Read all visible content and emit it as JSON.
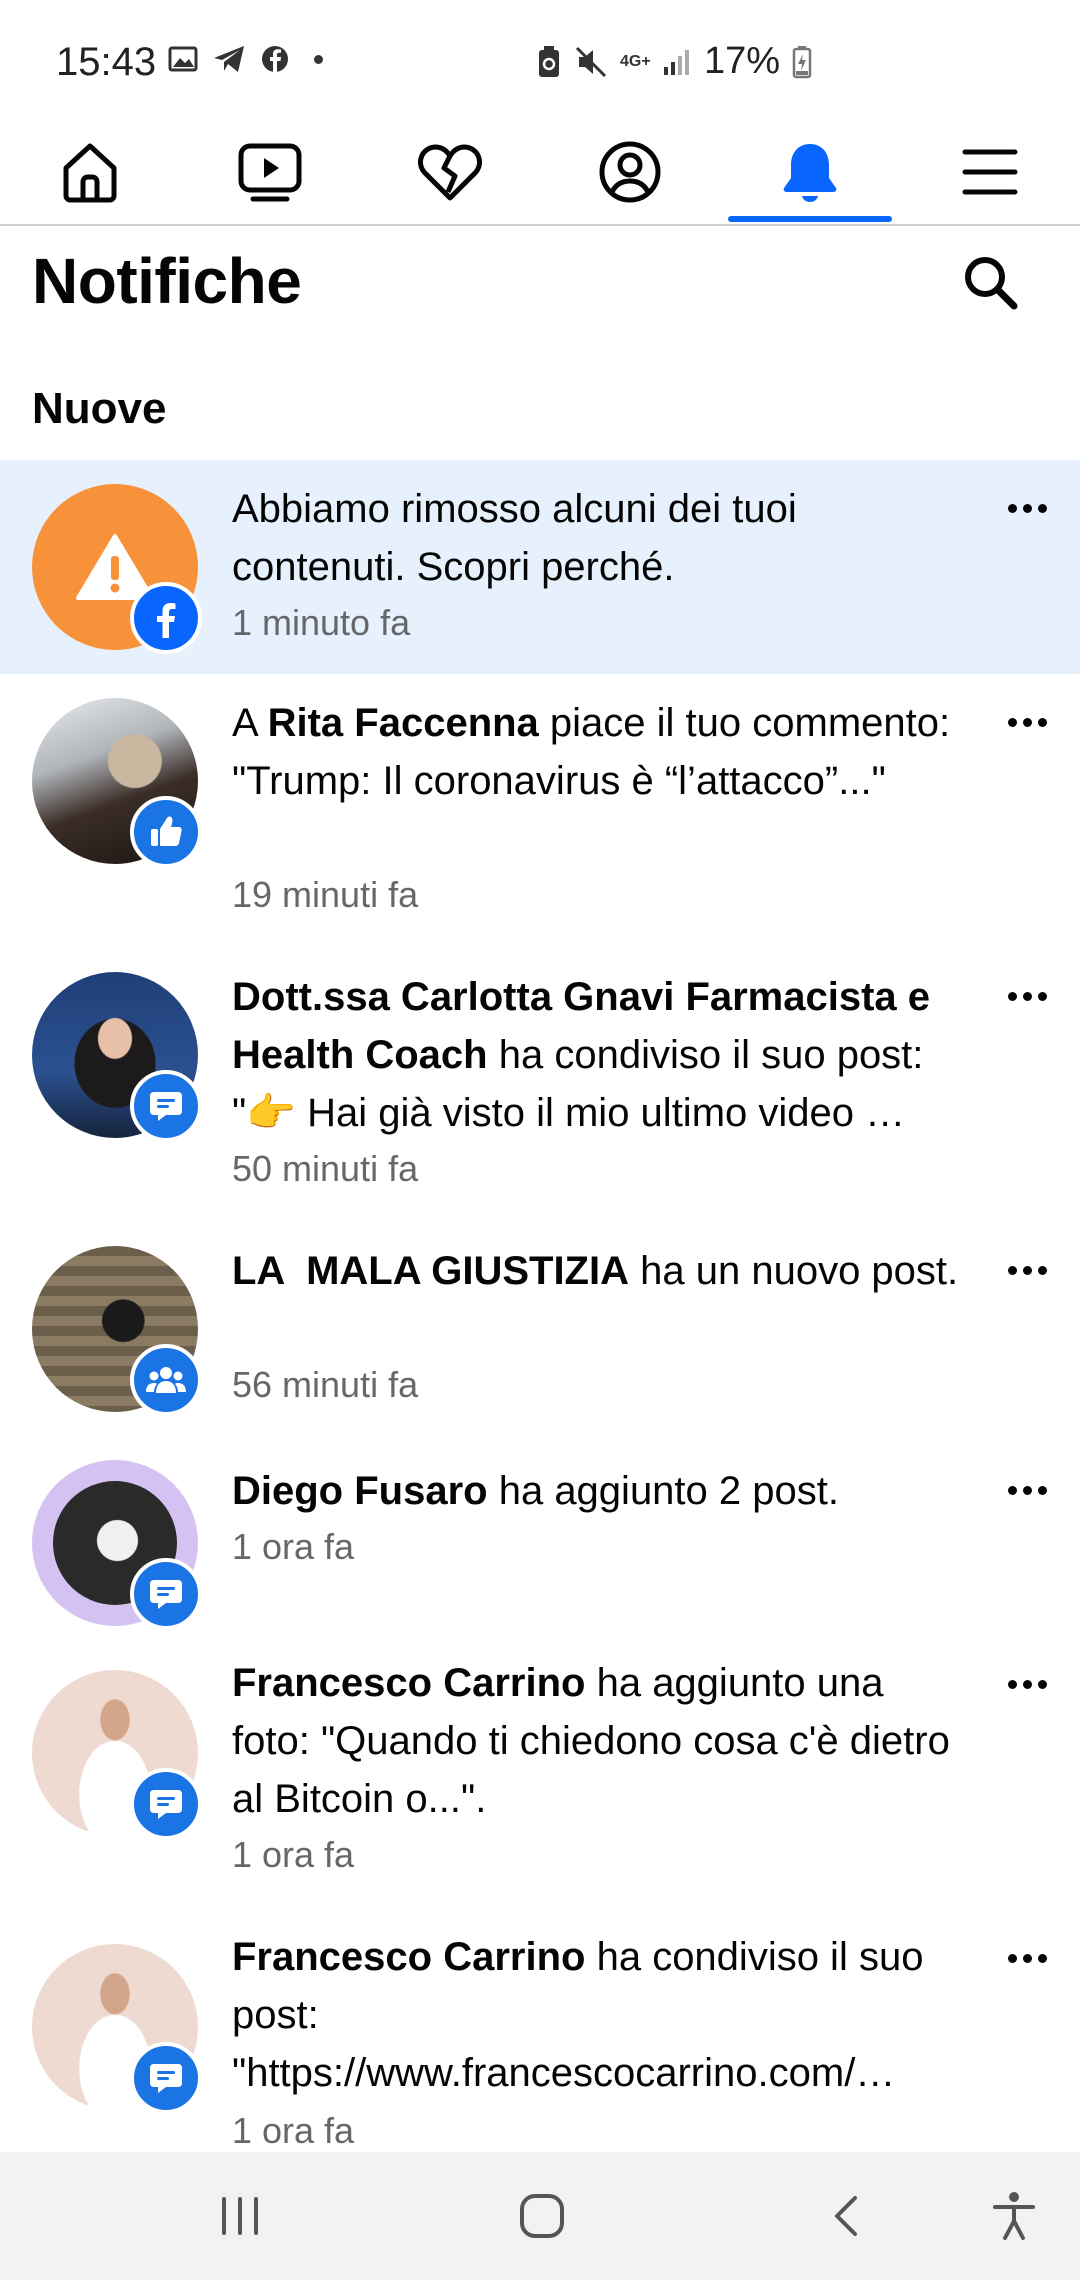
{
  "status": {
    "time": "15:43",
    "battery": "17%",
    "network": "4G+"
  },
  "nav": {
    "items": [
      "home-icon",
      "video-icon",
      "dating-heart-icon",
      "profile-icon",
      "notifications-bell-icon",
      "menu-icon"
    ],
    "active": "notifications-bell-icon",
    "accent": "#0866ff"
  },
  "header": {
    "title": "Notifiche",
    "section": "Nuove"
  },
  "notifications": [
    {
      "pre": "",
      "bold": "",
      "text": "Abbiamo rimosso alcuni dei tuoi contenuti. Scopri perché.",
      "time": "1 minuto fa",
      "badge": "facebook-icon",
      "unread": true
    },
    {
      "pre": "A ",
      "bold": "Rita Faccenna",
      "text": " piace il tuo commento: \"Trump: Il coronavirus è “l’attacco”...\"",
      "time": "19 minuti fa",
      "badge": "like-thumb-icon"
    },
    {
      "pre": "",
      "bold": "Dott.ssa Carlotta Gnavi Farmacista e Health Coach",
      "text": " ha condiviso il suo post: \"👉 Hai già visto il mio ultimo video …",
      "time": "50 minuti fa",
      "badge": "comment-icon"
    },
    {
      "pre": "",
      "bold": "LA  MALA GIUSTIZIA",
      "text": " ha un nuovo post.",
      "time": "56 minuti fa",
      "badge": "group-icon"
    },
    {
      "pre": "",
      "bold": "Diego Fusaro",
      "text": " ha aggiunto 2 post.",
      "time": "1 ora fa",
      "badge": "comment-icon"
    },
    {
      "pre": "",
      "bold": "Francesco Carrino",
      "text": " ha aggiunto una foto: \"Quando ti chiedono cosa c'è dietro al Bitcoin o...\".",
      "time": "1 ora fa",
      "badge": "comment-icon"
    },
    {
      "pre": "",
      "bold": "Francesco Carrino",
      "text": " ha condiviso il suo post: \"https://www.francescocarrino.com/…",
      "time": "1 ora fa",
      "badge": "comment-icon"
    }
  ],
  "system_nav": [
    "recent-apps-icon",
    "home-button-icon",
    "back-icon",
    "accessibility-icon"
  ]
}
